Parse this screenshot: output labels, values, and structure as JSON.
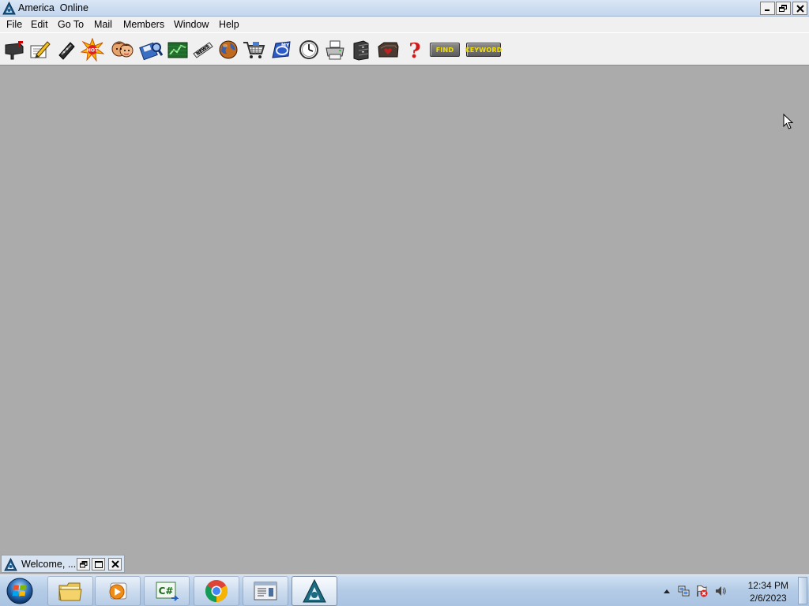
{
  "window": {
    "title": "America  Online",
    "controls": {
      "minimize": "minimize-icon",
      "restore": "restore-icon",
      "close": "close-icon"
    }
  },
  "menu": [
    "File",
    "Edit",
    "Go To",
    "Mail",
    "Members",
    "Window",
    "Help"
  ],
  "toolbar": {
    "icons": [
      "read-mail-icon",
      "compose-mail-icon",
      "mail-center-icon",
      "whats-hot-icon",
      "people-connection-icon",
      "file-search-icon",
      "stock-quotes-icon",
      "news-icon",
      "internet-globe-icon",
      "marketplace-cart-icon",
      "my-aol-icon",
      "clock-icon",
      "print-icon",
      "personal-filing-cabinet-icon",
      "favorite-places-icon",
      "help-icon"
    ],
    "find_label": "FIND",
    "keyword_label": "KEYWORD"
  },
  "minimized_window": {
    "title": "Welcome, ...",
    "controls": {
      "restore": "restore-icon",
      "maximize": "maximize-icon",
      "close": "close-icon"
    }
  },
  "taskbar": {
    "start": "windows-start-icon",
    "apps": [
      {
        "name": "file-explorer-icon",
        "state": "pinned"
      },
      {
        "name": "media-player-icon",
        "state": "pinned"
      },
      {
        "name": "csharp-editor-icon",
        "state": "pinned"
      },
      {
        "name": "chrome-icon",
        "state": "pinned"
      },
      {
        "name": "document-viewer-icon",
        "state": "pinned"
      },
      {
        "name": "aol-icon",
        "state": "active"
      }
    ],
    "tray": {
      "icons": [
        "show-hidden-icons-arrow",
        "network-icon",
        "action-center-flag-icon",
        "volume-icon"
      ],
      "time": "12:34 PM",
      "date": "2/6/2023"
    }
  },
  "colors": {
    "workspace": "#ababab",
    "titlebar": "#c3d6ee",
    "toolbar_word_text": "#f5e000",
    "taskbar": "#b3cbe6"
  }
}
